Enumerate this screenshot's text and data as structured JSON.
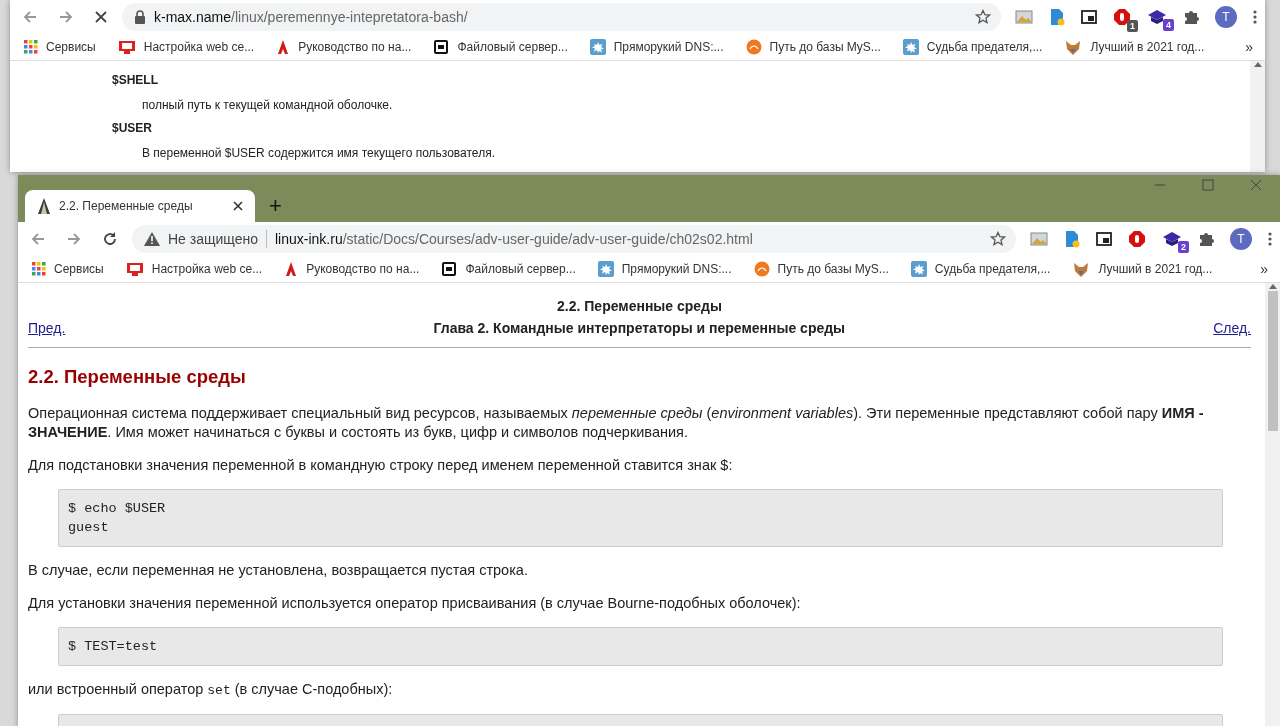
{
  "back_window": {
    "loading": true,
    "address": {
      "secure": true,
      "host": "k-max.name",
      "path": "/linux/peremennye-intepretatora-bash/"
    },
    "extensions": [
      {
        "kind": "photo"
      },
      {
        "kind": "doc"
      },
      {
        "kind": "pip"
      },
      {
        "kind": "block",
        "badge": "1"
      },
      {
        "kind": "cap",
        "badge": "4"
      },
      {
        "kind": "puzzle"
      }
    ],
    "profile_initial": "T",
    "bookmarks": [
      {
        "kind": "apps",
        "label": "Сервисы"
      },
      {
        "kind": "screen",
        "label": "Настройка web се..."
      },
      {
        "kind": "letter",
        "label": "Руководство по на..."
      },
      {
        "kind": "square",
        "label": "Файловый сервер..."
      },
      {
        "kind": "splash",
        "label": "Пряморукий DNS:..."
      },
      {
        "kind": "orange",
        "label": "Путь до базы MyS..."
      },
      {
        "kind": "splash",
        "label": "Судьба предателя,..."
      },
      {
        "kind": "fox",
        "label": "Лучший в 2021 год..."
      }
    ],
    "bookmarks_more": "»",
    "page": {
      "terms": [
        {
          "term": "$SHELL",
          "definition": "полный путь к текущей командной оболочке."
        },
        {
          "term": "$USER",
          "definition": "В переменной $USER содержится имя текущего пользователя."
        }
      ]
    }
  },
  "front_window": {
    "tabs": [
      {
        "title": "2.2. Переменные среды",
        "selected": true
      }
    ],
    "new_tab": "+",
    "loading": false,
    "address": {
      "secure": false,
      "security_label": "Не защищено",
      "host": "linux-ink.ru",
      "path": "/static/Docs/Courses/adv-user-guide/adv-user-guide/ch02s02.html"
    },
    "extensions": [
      {
        "kind": "photo"
      },
      {
        "kind": "doc"
      },
      {
        "kind": "pip"
      },
      {
        "kind": "block"
      },
      {
        "kind": "cap",
        "badge": "2"
      },
      {
        "kind": "puzzle"
      }
    ],
    "profile_initial": "T",
    "bookmarks": [
      {
        "kind": "apps",
        "label": "Сервисы"
      },
      {
        "kind": "screen",
        "label": "Настройка web се..."
      },
      {
        "kind": "letter",
        "label": "Руководство по на..."
      },
      {
        "kind": "square",
        "label": "Файловый сервер..."
      },
      {
        "kind": "splash",
        "label": "Пряморукий DNS:..."
      },
      {
        "kind": "orange",
        "label": "Путь до базы MyS..."
      },
      {
        "kind": "splash",
        "label": "Судьба предателя,..."
      },
      {
        "kind": "fox",
        "label": "Лучший в 2021 год..."
      }
    ],
    "bookmarks_more": "»",
    "page": {
      "header_title": "2.2. Переменные среды",
      "prev_link": "Пред.",
      "chapter_title": "Глава 2. Командные интерпретаторы и переменные среды",
      "next_link": "След.",
      "heading": "2.2. Переменные среды",
      "blocks": [
        {
          "kind": "para",
          "text": "Операционная система поддерживает специальный вид ресурсов, называемых *переменные среды* (*environment variables*). Эти переменные представляют собой пару **ИМЯ - ЗНАЧЕНИЕ**. Имя может начинаться с буквы и состоять из букв, цифр и символов подчеркивания."
        },
        {
          "kind": "para",
          "text": "Для подстановки значения переменной в командную строку перед именем переменной ставится знак $:"
        },
        {
          "kind": "code",
          "lines": [
            "$ echo $USER",
            "guest"
          ]
        },
        {
          "kind": "para",
          "text": "В случае, если переменная не установлена, возвращается пустая строка."
        },
        {
          "kind": "para",
          "text": "Для установки значения переменной используется оператор присваивания (в случае Bourne-подобных оболочек):"
        },
        {
          "kind": "code",
          "lines": [
            "$ TEST=test"
          ]
        },
        {
          "kind": "mixed",
          "parts": [
            {
              "kind": "text",
              "text": "или встроенный оператор "
            },
            {
              "kind": "code",
              "text": "set"
            },
            {
              "kind": "text",
              "text": " (в случае C-подобных):"
            }
          ]
        },
        {
          "kind": "code"
        }
      ]
    }
  }
}
